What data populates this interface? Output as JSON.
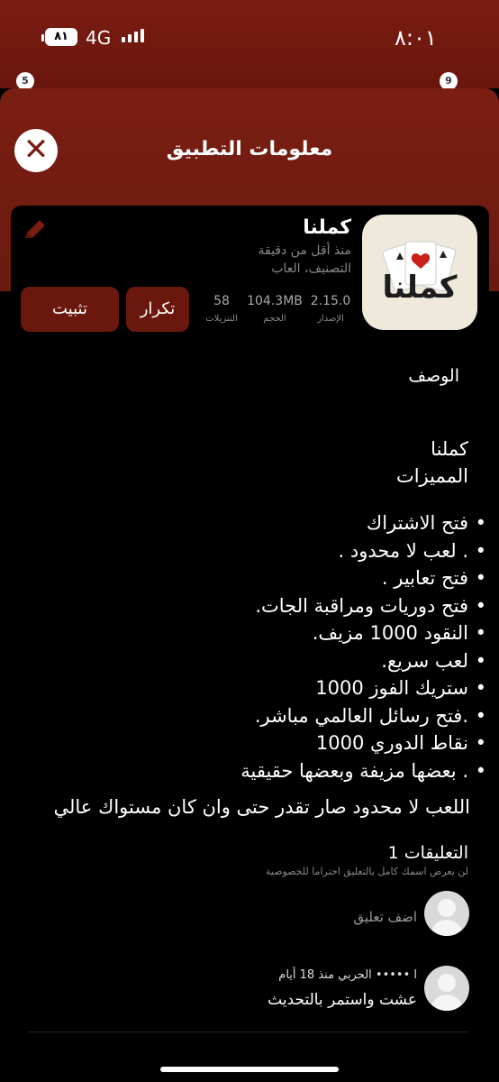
{
  "status": {
    "time": "٨:٠١",
    "battery": "٨١",
    "network": "4G"
  },
  "background": {
    "badge_left": "5",
    "badge_right": "9"
  },
  "sheet": {
    "title": "معلومات التطبيق"
  },
  "app": {
    "name": "كملنا",
    "updated": "منذ أقل من دقيقة",
    "category": "التصنيف، العاب",
    "icon_text": "كملنا",
    "stats": [
      {
        "value": "2.15.0",
        "label": "الإصدار"
      },
      {
        "value": "104.3MB",
        "label": "الحجم"
      },
      {
        "value": "58",
        "label": "التنزيلات"
      }
    ],
    "repeat_label": "تكرار",
    "install_label": "تثبيت"
  },
  "description": {
    "heading": "الوصف",
    "title_line": "كملنا",
    "features_heading": "المميزات",
    "features": [
      "فتح الاشتراك",
      ". لعب لا محدود .",
      "فتح تعابير .",
      "فتح دوريات ومراقبة الجات.",
      "النقود 1000 مزيف.",
      "لعب سريع.",
      "ستريك الفوز 1000",
      ".فتح رسائل العالمي مباشر.",
      "نقاط الدوري 1000",
      ". بعضها مزيفة وبعضها حقيقية"
    ],
    "summary": "اللعب لا محدود صار تقدر حتى وان كان مستواك عالي"
  },
  "comments": {
    "title": "التعليقات 1",
    "note": "لن يعرض اسمك كامل بالتعليق احتراما للخصوصية",
    "add_placeholder": "اضف تعليق",
    "items": [
      {
        "meta": "ا ••••• الحربي منذ 18 أيام",
        "text": "عشت واستمر بالتحديث"
      }
    ]
  },
  "colors": {
    "accent": "#7a1c12",
    "button": "#6a180d",
    "background": "#000000"
  }
}
